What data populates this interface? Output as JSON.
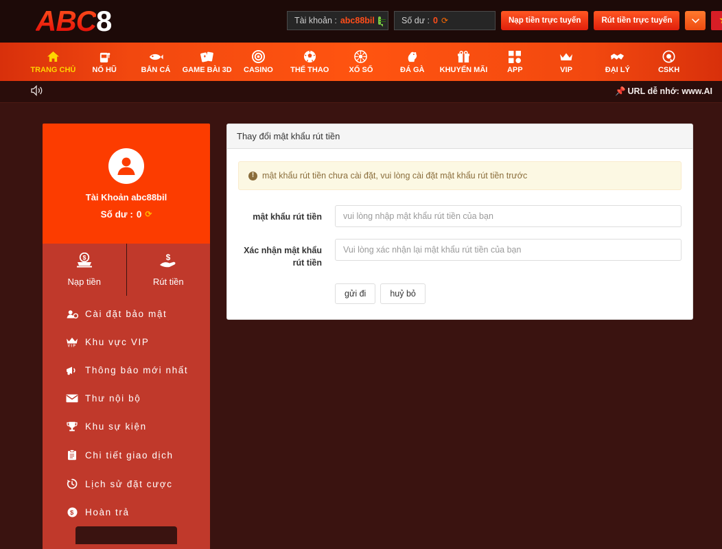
{
  "brand": {
    "name_red": "ABC",
    "name_white": "8",
    "accent": "#fc3c00",
    "sidebar_red": "#c0392b",
    "bg": "#3a1310"
  },
  "topbar": {
    "account_label": "Tài khoản :",
    "account_value": "abc88bil",
    "balance_label": "Số dư :",
    "balance_value": "0",
    "deposit_button": "Nạp tiền trực tuyến",
    "withdraw_button": "Rút tiền trực tuyến",
    "caret": "⌄",
    "flag_star": "★"
  },
  "nav": {
    "items": [
      {
        "label": "TRANG CHỦ",
        "icon": "home-icon",
        "active": true
      },
      {
        "label": "NỔ HŨ",
        "icon": "slot-machine-icon",
        "active": false
      },
      {
        "label": "BẮN CÁ",
        "icon": "fish-icon",
        "active": false
      },
      {
        "label": "GAME BÀI 3D",
        "icon": "cards-icon",
        "active": false
      },
      {
        "label": "CASINO",
        "icon": "casino-chip-icon",
        "active": false
      },
      {
        "label": "THỂ THAO",
        "icon": "soccer-ball-icon",
        "active": false
      },
      {
        "label": "XỔ SỐ",
        "icon": "lottery-wheel-icon",
        "active": false
      },
      {
        "label": "ĐÁ GÀ",
        "icon": "rooster-icon",
        "active": false
      },
      {
        "label": "KHUYẾN MÃI",
        "icon": "gift-icon",
        "active": false
      },
      {
        "label": "APP",
        "icon": "grid-apps-icon",
        "active": false
      },
      {
        "label": "VIP",
        "icon": "crown-icon",
        "active": false
      },
      {
        "label": "ĐẠI LÝ",
        "icon": "handshake-icon",
        "active": false
      },
      {
        "label": "CSKH",
        "icon": "support-chat-icon",
        "active": false
      }
    ]
  },
  "marquee": {
    "speaker_icon": "speaker-icon",
    "pin_icon": "📌",
    "text": "URL dễ nhớ: www.AI"
  },
  "sidebar": {
    "profile": {
      "avatar_icon": "user-avatar-icon",
      "account_text": "Tài Khoản abc88bil",
      "balance_label": "Số dư : ",
      "balance_value": "0",
      "refresh_icon": "↻"
    },
    "actions": [
      {
        "label": "Nạp tiền",
        "icon": "deposit-coin-icon"
      },
      {
        "label": "Rút tiền",
        "icon": "withdraw-hand-icon"
      }
    ],
    "menu": [
      {
        "label": "Cài đặt bảo mật",
        "icon": "user-shield-icon"
      },
      {
        "label": "Khu vực VIP",
        "icon": "vip-crown-icon"
      },
      {
        "label": "Thông báo mới nhất",
        "icon": "megaphone-icon"
      },
      {
        "label": "Thư nội bộ",
        "icon": "envelope-icon"
      },
      {
        "label": "Khu sự kiện",
        "icon": "trophy-icon"
      },
      {
        "label": "Chi tiết giao dịch",
        "icon": "clipboard-icon"
      },
      {
        "label": "Lịch sử đặt cược",
        "icon": "history-clock-icon"
      },
      {
        "label": "Hoàn trả",
        "icon": "dollar-circle-icon"
      }
    ]
  },
  "panel": {
    "title": "Thay đổi mật khẩu rút tiền",
    "alert": {
      "icon": "!",
      "text": "mật khẩu rút tiền chưa cài đặt, vui lòng cài đặt mật khẩu rút tiền trước"
    },
    "fields": [
      {
        "label": "mật khẩu rút tiền",
        "placeholder": "vui lòng nhập mật khẩu rút tiền của bạn",
        "value": ""
      },
      {
        "label": "Xác nhận mật khẩu rút tiền",
        "placeholder": "Vui lòng xác nhận lại mật khẩu rút tiền của bạn",
        "value": ""
      }
    ],
    "submit_label": "gửi đi",
    "cancel_label": "huỷ bỏ"
  }
}
